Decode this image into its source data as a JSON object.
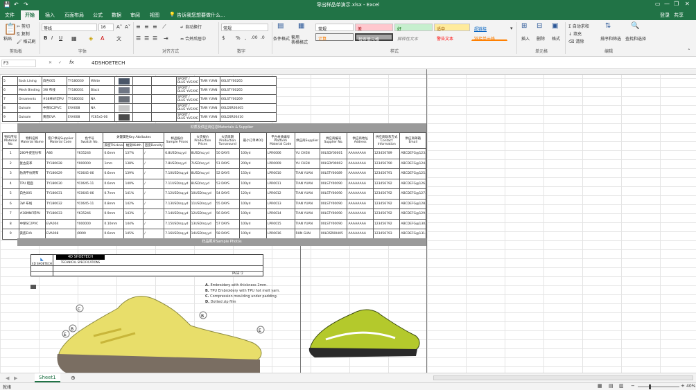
{
  "titlebar": {
    "title": "导出样品单演示.xlsx - Excel"
  },
  "tabs": [
    {
      "label": "文件"
    },
    {
      "label": "开始"
    },
    {
      "label": "插入"
    },
    {
      "label": "页面布局"
    },
    {
      "label": "公式"
    },
    {
      "label": "数据"
    },
    {
      "label": "审阅"
    },
    {
      "label": "视图"
    },
    {
      "label": "告诉我您想要做什么..."
    }
  ],
  "account": {
    "login": "登录",
    "share": "共享"
  },
  "ribbon": {
    "clipboard": {
      "paste": "粘贴",
      "cut": "剪切",
      "copy": "复制",
      "painter": "格式刷",
      "group": "剪贴板"
    },
    "font": {
      "name": "等线",
      "size": "16",
      "group": "字体",
      "bold": "B",
      "italic": "I",
      "underline": "U"
    },
    "align": {
      "wrap": "自动换行",
      "merge": "合并后居中",
      "group": "对齐方式"
    },
    "number": {
      "format": "常规",
      "percent": "%",
      "comma": ",",
      "group": "数字"
    },
    "styles": {
      "cond": "条件格式",
      "table": "套用\n表格格式",
      "group": "样式",
      "cells": [
        "常规",
        "差",
        "好",
        "适中",
        "超链接",
        "计算",
        "检查单元格",
        "解释性文本",
        "警告文本",
        "链接单元格"
      ]
    },
    "cells": {
      "insert": "插入",
      "delete": "删除",
      "format": "格式",
      "group": "单元格"
    },
    "editing": {
      "autosum": "自动求和",
      "fill": "填充",
      "clear": "清除",
      "sort": "排序和筛选",
      "find": "查找和选择",
      "group": "编辑"
    }
  },
  "formula": {
    "namebox": "F3",
    "fx": "fx",
    "value": "4DSHOETECH"
  },
  "top_rows": [
    {
      "n": "5",
      "part": "Sock Lining",
      "a": "白色005",
      "b": "TY180030",
      "c": "White",
      "sup": "SPORT / BLUE YVEAYE",
      "f": "TIAN YUAN",
      "g": "00LSTY00265"
    },
    {
      "n": "6",
      "part": "Mesh Binding",
      "a": "3W 布线",
      "b": "TY180031",
      "c": "Black",
      "sup": "SPORT / BLUE YVEAYE",
      "f": "TIAN YUAN",
      "g": "00LSTY00265"
    },
    {
      "n": "7",
      "part": "Ornaments",
      "a": "#38MNF印PU",
      "b": "TY180032",
      "c": "NA",
      "sup": "SPORT / BLUE YVEAYE",
      "f": "TIAN YUAN",
      "g": "00LSTY00269"
    },
    {
      "n": "8",
      "part": "Outsole",
      "a": "中保SC2PVC",
      "b": "EVA008",
      "c": "NA",
      "sup": "SPORT / BLUE YVEAYE",
      "f": "TIAN YUAN",
      "g": "00LDSR00405"
    },
    {
      "n": "9",
      "part": "Outsole",
      "a": "黄底EVA",
      "b": "EVA008",
      "c": "YC65x5-06",
      "sup": "SPORT / BLUE YVEAYE",
      "f": "TIAN YUAN",
      "g": "00LDSR00410"
    }
  ],
  "section1": "材质及供应商信息Materials & Supplier",
  "headers": [
    "物料序号\nMaterial No.",
    "物料名称\nMaterial Name",
    "客户供号Supplier Material Code",
    "色卡号\nSwatch No.",
    "关键属性Key Attributes",
    "样品报价\nSample Prices",
    "大货报价\nProduction Prices",
    "大货周期\nProduction Turnaround",
    "最小订单MOQ",
    "平台材质编号\nPlatform Material Code",
    "供应商Supplier",
    "供应商编号\nSupplier No.",
    "供应商地址\nAddress",
    "供应商联系方式\nContact Information",
    "供应商邮箱\nEmail"
  ],
  "subheaders": [
    "厚度Thickness",
    "幅宽Width",
    "密度Density"
  ],
  "rows": [
    {
      "n": "1",
      "name": "280牛皮压纹布",
      "code": "A86",
      "sw": "Y635246",
      "t": "0.6mm",
      "w": "137%",
      "d": "/",
      "sp": "6.8USD/sq.yd",
      "pp": "8USD/sq.yd",
      "tt": "50 DAYS",
      "moq": "100yd",
      "pm": "LPR0006",
      "sup": "YU CHEN",
      "sn": "00LSDY00001",
      "ad": "AAAAAAAA",
      "ci": "123456789",
      "em": "ABCDEFG@123.COM"
    },
    {
      "n": "2",
      "name": "复古皮革",
      "code": "TY180028",
      "sw": "Y000000",
      "t": "1mm",
      "w": "138%",
      "d": "/",
      "sp": "7.8USD/sq.yd",
      "pp": "7USD/sq.yd",
      "tt": "51 DAYS",
      "moq": "200yd",
      "pm": "LPR0009",
      "sup": "YU CHEN",
      "sn": "00LSDY00002",
      "ad": "AAAAAAAA",
      "ci": "123456790",
      "em": "ABCDEFG@124.COM"
    },
    {
      "n": "3",
      "name": "防滑平纹网布",
      "code": "TY180029",
      "sw": "YC0645-06",
      "t": "0.6mm",
      "w": "139%",
      "d": "/",
      "sp": "7.10USD/sq.yd",
      "pp": "8USD/sq.yd",
      "tt": "52 DAYS",
      "moq": "150yd",
      "pm": "LPR0010",
      "sup": "TIAN YUAN",
      "sn": "00LSTY00089",
      "ad": "AAAAAAAA",
      "ci": "123456791",
      "em": "ABCDEFG@125.COM"
    },
    {
      "n": "4",
      "name": "TPU 鞋面",
      "code": "TY180030",
      "sw": "YC0645-11",
      "t": "0.6mm",
      "w": "140%",
      "d": "/",
      "sp": "7.11USD/sq.yd",
      "pp": "8USD/sq.yd",
      "tt": "53 DAYS",
      "moq": "100yd",
      "pm": "LPR0011",
      "sup": "TIAN YUAN",
      "sn": "00LSTY00090",
      "ad": "AAAAAAAA",
      "ci": "123456792",
      "em": "ABCDEFG@126.COM"
    },
    {
      "n": "5",
      "name": "白色005",
      "code": "TY180031",
      "sw": "YC0645-06",
      "t": "0.7mm",
      "w": "141%",
      "d": "/",
      "sp": "7.12USD/sq.yd",
      "pp": "10USD/sq.yd",
      "tt": "54 DAYS",
      "moq": "120yd",
      "pm": "LPR0012",
      "sup": "TIAN YUAN",
      "sn": "00LSTY00090",
      "ad": "AAAAAAAA",
      "ci": "123456792",
      "em": "ABCDEFG@127.COM"
    },
    {
      "n": "6",
      "name": "3W 布线",
      "code": "TY180032",
      "sw": "YC0645-11",
      "t": "0.8mm",
      "w": "142%",
      "d": "/",
      "sp": "7.13USD/sq.yd",
      "pp": "11USD/sq.yd",
      "tt": "55 DAYS",
      "moq": "100yd",
      "pm": "LPR0013",
      "sup": "TIAN YUAN",
      "sn": "00LSTY00090",
      "ad": "AAAAAAAA",
      "ci": "123456792",
      "em": "ABCDEFG@128.COM"
    },
    {
      "n": "7",
      "name": "#38MNF印PU",
      "code": "TY180033",
      "sw": "Y635246",
      "t": "0.9mm",
      "w": "143%",
      "d": "/",
      "sp": "7.14USD/sq.yd",
      "pp": "12USD/sq.yd",
      "tt": "56 DAYS",
      "moq": "100yd",
      "pm": "LPR0014",
      "sup": "TIAN YUAN",
      "sn": "00LSTY00090",
      "ad": "AAAAAAAA",
      "ci": "123456792",
      "em": "ABCDEFG@129.COM"
    },
    {
      "n": "8",
      "name": "中保SC2PVC",
      "code": "EVA004",
      "sw": "Y000000",
      "t": "0.10mm",
      "w": "144%",
      "d": "/",
      "sp": "7.15USD/sq.yd",
      "pp": "13USD/sq.yd",
      "tt": "57 DAYS",
      "moq": "100yd",
      "pm": "LPR0015",
      "sup": "TIAN YUAN",
      "sn": "00LSTY00090",
      "ad": "AAAAAAAA",
      "ci": "123456792",
      "em": "ABCDEFG@130.COM"
    },
    {
      "n": "9",
      "name": "黄底EVA",
      "code": "EVA008",
      "sw": "/9999",
      "t": "0.6mm",
      "w": "145%",
      "d": "/",
      "sp": "7.16USD/sq.yd",
      "pp": "14USD/sq.yd",
      "tt": "58 DAYS",
      "moq": "100yd",
      "pm": "LPR0016",
      "sup": "RUN GUN",
      "sn": "00LDSR00405",
      "ad": "AAAAAAAA",
      "ci": "123456793",
      "em": "ABCDEFG@131.COM"
    }
  ],
  "section2": "样品照片Sample Photos",
  "spec": {
    "brand": "4D SHOETECH",
    "subtitle": "TECHNICAL SPECIFICATIONS",
    "page": "PAGE: 2",
    "callouts": [
      "Embroidery with thickness 2mm.",
      "TPU Embroidery with TPU hot melt yarn.",
      "Compression moulding under padding.",
      "Dotted zip film"
    ],
    "letters": [
      "A.",
      "B.",
      "C.",
      "D."
    ]
  },
  "sheettab": "Sheet1",
  "status": {
    "ready": "就绪",
    "zoom": "40%"
  }
}
